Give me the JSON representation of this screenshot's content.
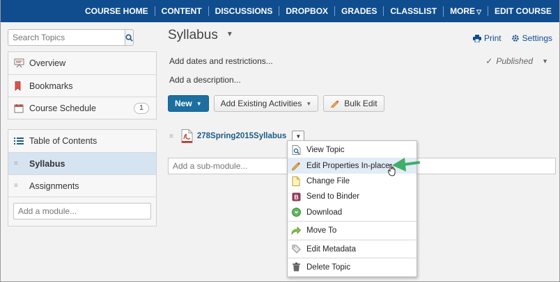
{
  "nav": {
    "items": [
      "COURSE HOME",
      "CONTENT",
      "DISCUSSIONS",
      "DROPBOX",
      "GRADES",
      "CLASSLIST",
      "MORE",
      "EDIT COURSE"
    ]
  },
  "sidebar": {
    "search_placeholder": "Search Topics",
    "group1": [
      {
        "label": "Overview",
        "icon": "overview-icon"
      },
      {
        "label": "Bookmarks",
        "icon": "bookmark-icon"
      },
      {
        "label": "Course Schedule",
        "icon": "calendar-icon",
        "badge": "1"
      }
    ],
    "toc_label": "Table of Contents",
    "modules": [
      "Syllabus",
      "Assignments"
    ],
    "add_module_placeholder": "Add a module..."
  },
  "main": {
    "title": "Syllabus",
    "print_label": "Print",
    "settings_label": "Settings",
    "dates_label": "Add dates and restrictions...",
    "status_label": "Published",
    "description_label": "Add a description...",
    "new_label": "New",
    "add_existing_label": "Add Existing Activities",
    "bulk_edit_label": "Bulk Edit",
    "topic_name": "278Spring2015Syllabus",
    "sub_module_placeholder": "Add a sub-module..."
  },
  "menu": {
    "items": [
      "View Topic",
      "Edit Properties In-place",
      "Change File",
      "Send to Binder",
      "Download",
      "Move To",
      "Edit Metadata",
      "Delete Topic"
    ]
  },
  "colors": {
    "nav_bg": "#104d8f",
    "primary_button": "#1c6fa0",
    "link": "#1b5b87",
    "active_item": "#d6e4f2",
    "arrow": "#3fae6a"
  }
}
